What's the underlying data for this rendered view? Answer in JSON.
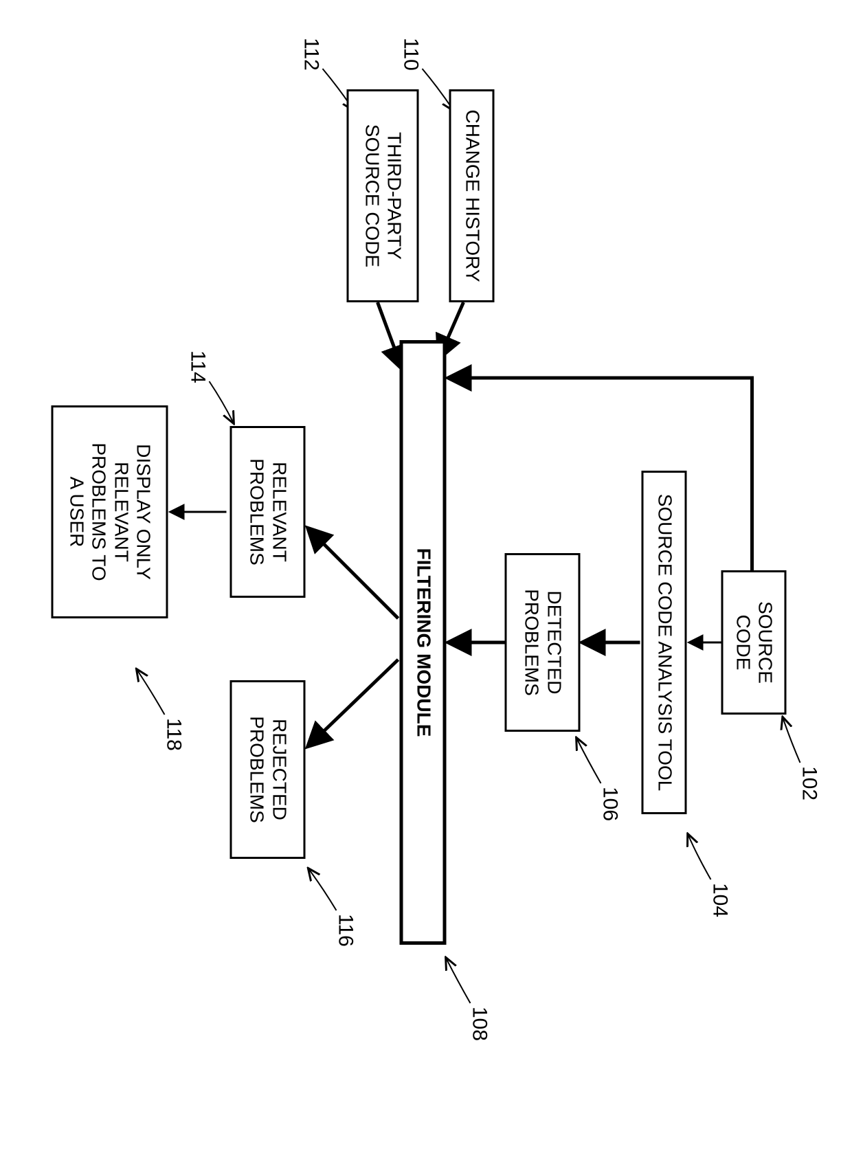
{
  "nodes": {
    "source_code": {
      "label": "SOURCE\nCODE",
      "ref": "102"
    },
    "analysis_tool": {
      "label": "SOURCE CODE ANALYSIS TOOL",
      "ref": "104"
    },
    "detected": {
      "label": "DETECTED\nPROBLEMS",
      "ref": "106"
    },
    "filtering": {
      "label": "FILTERING MODULE",
      "ref": "108"
    },
    "change_history": {
      "label": "CHANGE HISTORY",
      "ref": "110"
    },
    "third_party": {
      "label": "THIRD-PARTY\nSOURCE CODE",
      "ref": "112"
    },
    "relevant": {
      "label": "RELEVANT\nPROBLEMS",
      "ref": "114"
    },
    "rejected": {
      "label": "REJECTED\nPROBLEMS",
      "ref": "116"
    },
    "display": {
      "label": "DISPLAY ONLY\nRELEVANT\nPROBLEMS TO\nA USER",
      "ref": "118"
    }
  }
}
